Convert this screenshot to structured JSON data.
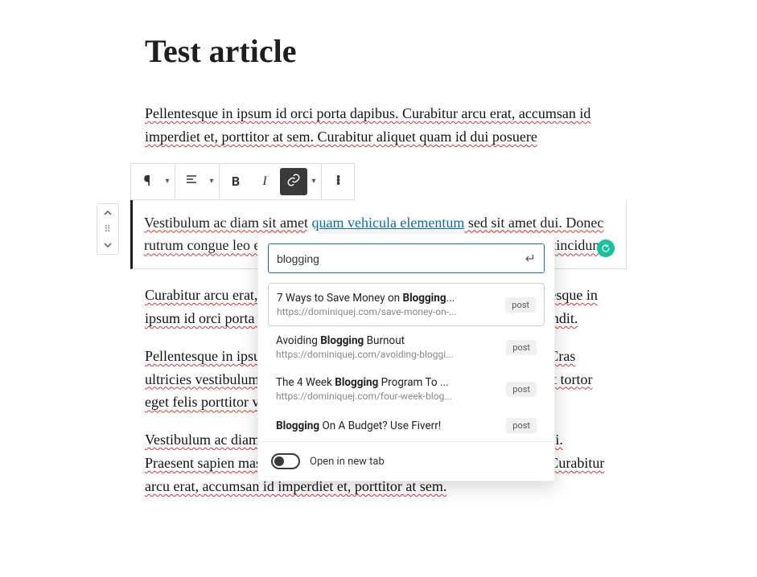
{
  "title": "Test article",
  "paragraphs": {
    "p1": "Pellentesque in ipsum id orci porta dapibus. Curabitur arcu erat, accumsan id imperdiet et, porttitor at sem. Curabitur aliquet quam id dui posuere",
    "editing_pre": "Vestibulum ac diam sit amet ",
    "editing_link": "quam vehicula elementum",
    "editing_post_1": " sed sit amet dui. Donec rutrum congue leo eget malesuada. Vivamus magna justo, lacinia eget tincidunt.",
    "p3": "Curabitur arcu erat, accumsan id imperdiet et, porttitor at sem. Pellentesque in ipsum id orci porta dapibus. Curabitur aliquet quam id dui posuere blandit.",
    "p4": "Pellentesque in ipsum id orci porta dapibus. Sed porttitor lectus nibh. Cras ultricies vestibulum ut lacinia in, elementum id enim. Vivamus suscipit tortor eget felis porttitor volutpat  consectetur sed, convallis at tellus.",
    "p5": "Vestibulum ac diam sit amet quam vehicula elementum sed sit amet dui. Praesent sapien massa, convallis a pellentesque nec, egestas non nisi. Curabitur arcu erat, accumsan id imperdiet et, porttitor at sem."
  },
  "toolbar": {
    "paragraph_icon": "pilcrow-icon",
    "align_icon": "align-left-icon",
    "bold_label": "B",
    "italic_label": "I",
    "link_icon": "link-icon",
    "more_icon": "more-icon"
  },
  "link_popover": {
    "search_value": "blogging",
    "submit_icon": "return-icon",
    "results": [
      {
        "title_pre": "7 Ways to Save Money on ",
        "title_bold": "Blogging",
        "title_post": "...",
        "url": "https://dominiquej.com/save-money-on-...",
        "badge": "post",
        "selected": true
      },
      {
        "title_pre": "Avoiding ",
        "title_bold": "Blogging",
        "title_post": " Burnout",
        "url": "https://dominiquej.com/avoiding-bloggi...",
        "badge": "post",
        "selected": false
      },
      {
        "title_pre": "The 4 Week ",
        "title_bold": "Blogging",
        "title_post": " Program To ...",
        "url": "https://dominiquej.com/four-week-blog...",
        "badge": "post",
        "selected": false
      },
      {
        "title_pre": "",
        "title_bold": "Blogging",
        "title_post": " On A Budget? Use Fiverr!",
        "url": "",
        "badge": "post",
        "selected": false
      }
    ],
    "footer_toggle_label": "Open in new tab",
    "footer_toggle_state": false
  },
  "colors": {
    "link": "#0a6db3",
    "accent": "#0676a7",
    "grammarly": "#15c39a"
  }
}
